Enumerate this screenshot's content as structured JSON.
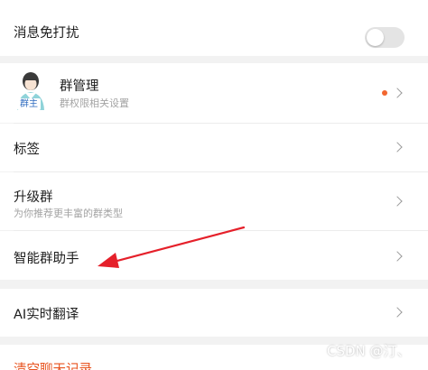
{
  "settings": {
    "mute_label": "消息免打扰",
    "group_manage": {
      "title": "群管理",
      "subtitle": "群权限相关设置",
      "avatar_badge": "群主",
      "has_dot": true
    },
    "tags_label": "标签",
    "upgrade": {
      "title": "升级群",
      "subtitle": "为你推荐更丰富的群类型"
    },
    "assistant_label": "智能群助手",
    "translate_label": "AI实时翻译",
    "clear_history_label": "清空聊天记录"
  },
  "colors": {
    "accent_red": "#e8531f",
    "dot_orange": "#f2662f",
    "annotation_red": "#e5202a"
  },
  "watermark": "CSDN @汀、"
}
